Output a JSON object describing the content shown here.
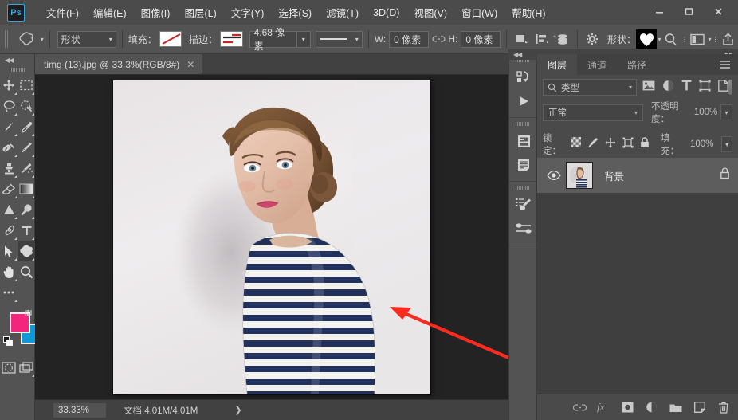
{
  "app": {
    "logo_text": "Ps"
  },
  "menubar": {
    "items": [
      {
        "label": "文件(F)"
      },
      {
        "label": "编辑(E)"
      },
      {
        "label": "图像(I)"
      },
      {
        "label": "图层(L)"
      },
      {
        "label": "文字(Y)"
      },
      {
        "label": "选择(S)"
      },
      {
        "label": "滤镜(T)"
      },
      {
        "label": "3D(D)"
      },
      {
        "label": "视图(V)"
      },
      {
        "label": "窗口(W)"
      },
      {
        "label": "帮助(H)"
      }
    ],
    "window_controls": [
      {
        "name": "minimize",
        "glyph": "—"
      },
      {
        "name": "maximize",
        "glyph": "□"
      },
      {
        "name": "close",
        "glyph": "✕"
      }
    ]
  },
  "options_bar": {
    "tool_icon": "custom-shape-tool-icon",
    "mode": {
      "value": "形状"
    },
    "fill": {
      "label": "填充：",
      "swatch": "none-diagonal-red"
    },
    "stroke": {
      "label": "描边：",
      "swatch": "stroke-red-dashes"
    },
    "stroke_width": {
      "value": "4.68 像素"
    },
    "stroke_style": {
      "value": "solid-line"
    },
    "width": {
      "label": "W:",
      "value": "0 像素"
    },
    "link": "link-icon",
    "height": {
      "label": "H:",
      "value": "0 像素"
    },
    "path_ops": "path-operations-icon",
    "path_align": "path-alignment-icon",
    "path_arrange": "path-arrangement-icon",
    "gear": "settings-gear-icon",
    "shape_label": "形状：",
    "shape_preset": "heart-shape-preview",
    "align_edges_icons": [
      "zoom-icon",
      "screen-mode-icon",
      "share-icon"
    ]
  },
  "toolbar": {
    "tools": [
      {
        "name": "move-tool",
        "row": 0,
        "col": 0
      },
      {
        "name": "rectangular-marquee-tool",
        "row": 0,
        "col": 1
      },
      {
        "name": "lasso-tool",
        "row": 1,
        "col": 0
      },
      {
        "name": "quick-selection-tool",
        "row": 1,
        "col": 1
      },
      {
        "name": "crop-tool",
        "row": 2,
        "col": 0
      },
      {
        "name": "eyedropper-tool",
        "row": 2,
        "col": 1
      },
      {
        "name": "healing-brush-tool",
        "row": 3,
        "col": 0
      },
      {
        "name": "brush-tool",
        "row": 3,
        "col": 1
      },
      {
        "name": "clone-stamp-tool",
        "row": 4,
        "col": 0
      },
      {
        "name": "history-brush-tool",
        "row": 4,
        "col": 1
      },
      {
        "name": "eraser-tool",
        "row": 5,
        "col": 0
      },
      {
        "name": "gradient-tool",
        "row": 5,
        "col": 1
      },
      {
        "name": "blur-tool",
        "row": 6,
        "col": 0
      },
      {
        "name": "dodge-tool",
        "row": 6,
        "col": 1
      },
      {
        "name": "pen-tool",
        "row": 7,
        "col": 0
      },
      {
        "name": "type-tool",
        "row": 7,
        "col": 1
      },
      {
        "name": "path-selection-tool",
        "row": 8,
        "col": 0
      },
      {
        "name": "custom-shape-tool",
        "row": 8,
        "col": 1,
        "selected": true
      },
      {
        "name": "hand-tool",
        "row": 9,
        "col": 0
      },
      {
        "name": "zoom-tool",
        "row": 9,
        "col": 1
      },
      {
        "name": "edit-toolbar-tool",
        "row": 10,
        "col": 0
      }
    ],
    "colors": {
      "foreground": "#F4257C",
      "background": "#0E9AD8"
    },
    "quick_mask": "quick-mask-icon",
    "screen_mode": "screen-mode-icon"
  },
  "document": {
    "tab_title": "timg (13).jpg @ 33.3%(RGB/8#)",
    "close_glyph": "✕"
  },
  "status_bar": {
    "zoom": "33.33%",
    "doc_info": "文档:4.01M/4.01M",
    "expand_glyph": "❯"
  },
  "middle_dock": {
    "icons": [
      {
        "name": "properties-icon"
      },
      {
        "name": "play-actions-icon"
      },
      {
        "name": "histogram-icon"
      },
      {
        "name": "notes-icon"
      },
      {
        "name": "brush-presets-icon"
      },
      {
        "name": "brush-settings-icon"
      }
    ]
  },
  "layers_panel": {
    "dock_collapse_left": "◀◀",
    "dock_collapse_right": "▶▶",
    "tabs": [
      {
        "label": "图层",
        "active": true
      },
      {
        "label": "通道",
        "active": false
      },
      {
        "label": "路径",
        "active": false
      }
    ],
    "menu_icon": "panel-menu-icon",
    "filter": {
      "search_icon": "search-icon",
      "value": "类型",
      "caret": "▾",
      "type_icons": [
        "pixel-filter-icon",
        "adjustment-filter-icon",
        "type-filter-icon",
        "shape-filter-icon",
        "smart-object-filter-icon"
      ],
      "toggle": "filter-toggle-switch"
    },
    "blend_mode": {
      "value": "正常",
      "caret": "▾"
    },
    "opacity": {
      "label": "不透明度：",
      "value": "100%",
      "stepper": "▾"
    },
    "lock": {
      "label": "锁定：",
      "icons": [
        "lock-transparent-pixels-icon",
        "lock-image-pixels-icon",
        "lock-position-icon",
        "lock-artboard-icon",
        "lock-all-icon"
      ]
    },
    "fill": {
      "label": "填充：",
      "value": "100%",
      "stepper": "▾"
    },
    "layers": [
      {
        "name": "背景",
        "visible": true,
        "locked": true,
        "thumbnail": "portrait-thumbnail"
      }
    ],
    "footer_icons": [
      {
        "name": "link-layers-icon"
      },
      {
        "name": "layer-style-fx-icon"
      },
      {
        "name": "layer-mask-icon"
      },
      {
        "name": "adjustment-layer-icon"
      },
      {
        "name": "new-group-icon"
      },
      {
        "name": "new-layer-icon"
      },
      {
        "name": "delete-layer-icon"
      }
    ]
  },
  "canvas": {
    "annotation": {
      "name": "red-arrow-annotation",
      "color": "#FB2B20"
    },
    "image_alt": "portrait-photo-striped-shirt"
  }
}
